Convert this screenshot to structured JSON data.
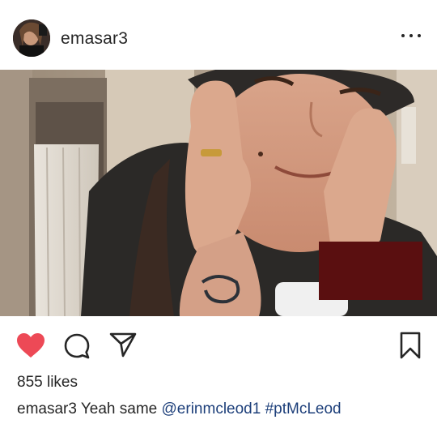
{
  "post": {
    "username": "emasar3",
    "likes_text": "855 likes",
    "caption": {
      "username": "emasar3",
      "text": "Yeah same",
      "mention": "@erinmcleod1",
      "hashtag": "#ptMcLeod"
    },
    "liked": true
  },
  "icons": {
    "more": "more-options-icon",
    "like": "heart-icon",
    "comment": "comment-icon",
    "share": "paper-plane-icon",
    "save": "bookmark-icon"
  },
  "colors": {
    "heart": "#ed4956",
    "text": "#262626",
    "link": "#1d3f7a"
  }
}
